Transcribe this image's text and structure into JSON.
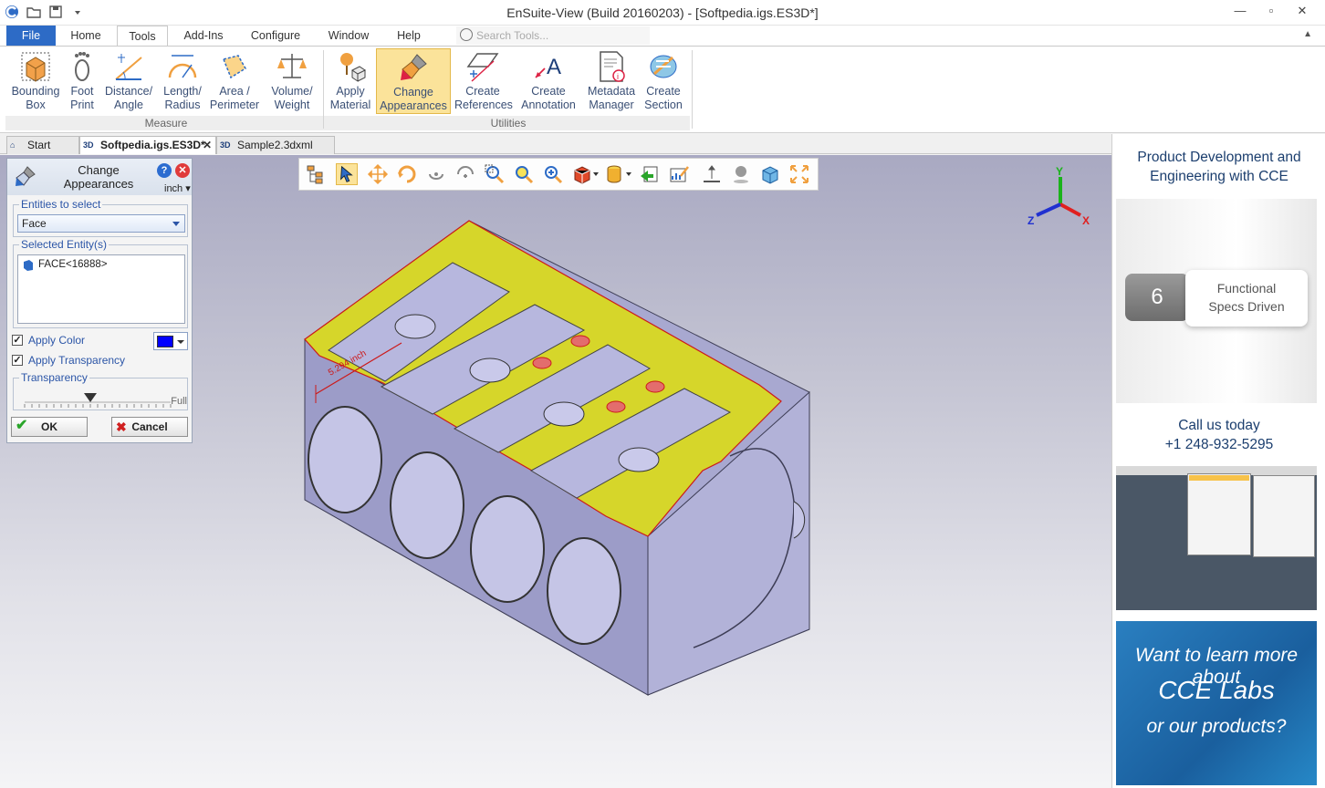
{
  "window": {
    "title": "EnSuite-View (Build 20160203) - [Softpedia.igs.ES3D*]",
    "controls": [
      "—",
      "▫",
      "✕"
    ]
  },
  "tabs": {
    "file": "File",
    "items": [
      "Home",
      "Tools",
      "Add-Ins",
      "Configure",
      "Window",
      "Help"
    ],
    "active": "Tools",
    "search_placeholder": "Search Tools..."
  },
  "ribbon": {
    "measure_group": "Measure",
    "utilities_group": "Utilities",
    "measure": [
      {
        "l1": "Bounding",
        "l2": "Box"
      },
      {
        "l1": "Foot",
        "l2": "Print"
      },
      {
        "l1": "Distance/",
        "l2": "Angle"
      },
      {
        "l1": "Length/",
        "l2": "Radius"
      },
      {
        "l1": "Area /",
        "l2": "Perimeter"
      },
      {
        "l1": "Volume/",
        "l2": "Weight"
      }
    ],
    "utilities": [
      {
        "l1": "Apply",
        "l2": "Material"
      },
      {
        "l1": "Change",
        "l2": "Appearances"
      },
      {
        "l1": "Create",
        "l2": "References"
      },
      {
        "l1": "Create",
        "l2": "Annotation"
      },
      {
        "l1": "Metadata",
        "l2": "Manager"
      },
      {
        "l1": "Create",
        "l2": "Section"
      }
    ]
  },
  "doctabs": [
    {
      "label": "Start Page",
      "icon": ""
    },
    {
      "label": "Softpedia.igs.ES3D*",
      "icon": "3D"
    },
    {
      "label": "Sample2.3dxml",
      "icon": "3D"
    }
  ],
  "panel": {
    "title1": "Change",
    "title2": "Appearances",
    "help": "?",
    "close": "✕",
    "unit": "inch ▾",
    "entities_legend": "Entities to select",
    "entities_value": "Face",
    "selected_legend": "Selected Entity(s)",
    "selected_item": "FACE<16888>",
    "apply_color": "Apply Color",
    "apply_transparency": "Apply Transparency",
    "transparency_legend": "Transparency",
    "transparency_full": "Full",
    "transparency_level": 0.45,
    "ok": "OK",
    "cancel": "Cancel",
    "check": "✓",
    "color": "#0000ff"
  },
  "viewport": {
    "dimension_label": "5.294 inch",
    "axes": {
      "x": "X",
      "y": "Y",
      "z": "Z"
    }
  },
  "ads": {
    "headline": [
      "Product Development and",
      "Engineering with CCE"
    ],
    "badge_number": "6",
    "badge_text": [
      "Functional",
      "Specs Driven"
    ],
    "call": [
      "Call us today",
      "+1 248-932-5295"
    ],
    "learn": [
      "Want to learn more about",
      "CCE Labs",
      "or our products?"
    ]
  },
  "colors": {
    "accent": "#2d6bc6",
    "face_highlight": "#d6d62a",
    "model": "#a9a9d2"
  }
}
